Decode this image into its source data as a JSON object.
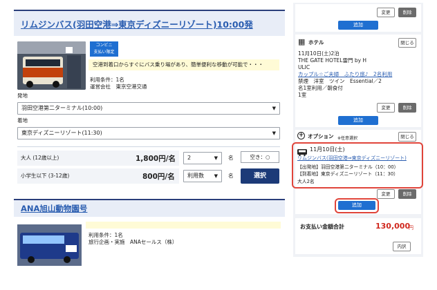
{
  "main": {
    "card1": {
      "title": "リムジンバス(羽田空港⇒東京ディズニーリゾート)10:00発",
      "badge_line1": "コンビニ",
      "badge_line2": "支払い限定",
      "notice": "空港到着口からすぐにバス乗り場があり、簡単便利な移動が可能で・・・",
      "condition": "利用条件：1名",
      "operator": "運営会社　東京空港交通",
      "departure_label": "発地",
      "departure_value": "羽田空港第二ターミナル(10:00)",
      "arrival_label": "着地",
      "arrival_value": "東京ディズニーリゾート(11:30)",
      "adult_label": "大人 (12歳以上)",
      "adult_price": "1,800円/名",
      "adult_qty": "2",
      "unit1": "名",
      "availability": "空き：○",
      "child_label": "小学生以下 (3-12歳)",
      "child_price": "800円/名",
      "child_qty": "利用数",
      "unit2": "名",
      "select_button": "選択"
    },
    "card2": {
      "title": "ANA旭山動物園号",
      "condition": "利用条件：1名",
      "organizer": "旅行企画・実施　ANAセールス（株）"
    }
  },
  "sidebar": {
    "top": {
      "change": "変更",
      "delete": "削除",
      "add": "追加"
    },
    "hotel": {
      "section": "ホテル",
      "close": "閉じる",
      "dates": "11月10日(土)2泊",
      "name_line1": "THE GATE HOTEL雷門 by H",
      "name_line2": "ULIC",
      "plan": "カップル☆ご夫婦　ふたり旅♪　2名利用",
      "room1": "禁煙　洋室　ツイン　Essential／2",
      "room2": "名1室利用／朝食付",
      "room3": "1室",
      "change": "変更",
      "delete": "削除",
      "add": "追加"
    },
    "option": {
      "section": "オプション",
      "optional": "※任意選択",
      "close": "閉じる",
      "date": "11月10日(土)",
      "bus_link": "リムジンバス(羽田空港⇒東京ディズニーリゾート)",
      "from": "【出発地】羽田空港第二ターミナル（10：00）",
      "to": "【到着地】東京ディズニーリゾート（11：30）",
      "pax": "大人2名",
      "change": "変更",
      "delete": "削除",
      "add": "追加"
    },
    "total": {
      "label": "お支払い金額合計",
      "amount": "130,000",
      "currency": "円",
      "details": "内訳"
    }
  }
}
